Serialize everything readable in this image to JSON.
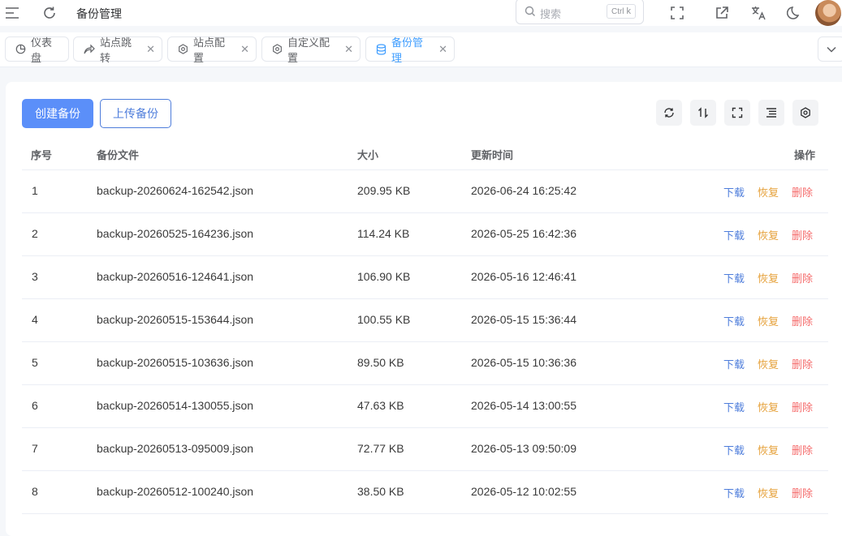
{
  "header": {
    "title": "备份管理",
    "search_placeholder": "搜索",
    "shortcut_key": "Ctrl",
    "shortcut_letter": "k"
  },
  "tabs": [
    {
      "label": "仪表盘",
      "icon": "dashboard-icon",
      "closable": false
    },
    {
      "label": "站点跳转",
      "icon": "share-arrow-icon",
      "closable": true
    },
    {
      "label": "站点配置",
      "icon": "gear-icon",
      "closable": true
    },
    {
      "label": "自定义配置",
      "icon": "gear-icon",
      "closable": true
    },
    {
      "label": "备份管理",
      "icon": "database-icon",
      "closable": true,
      "active": true
    }
  ],
  "toolbar": {
    "create_label": "创建备份",
    "upload_label": "上传备份"
  },
  "table": {
    "columns": [
      "序号",
      "备份文件",
      "大小",
      "更新时间",
      "操作"
    ],
    "actions": {
      "download": "下载",
      "restore": "恢复",
      "delete": "删除"
    },
    "rows": [
      {
        "no": "1",
        "file": "backup-20260624-162542.json",
        "size": "209.95 KB",
        "time": "2026-06-24 16:25:42"
      },
      {
        "no": "2",
        "file": "backup-20260525-164236.json",
        "size": "114.24 KB",
        "time": "2026-05-25 16:42:36"
      },
      {
        "no": "3",
        "file": "backup-20260516-124641.json",
        "size": "106.90 KB",
        "time": "2026-05-16 12:46:41"
      },
      {
        "no": "4",
        "file": "backup-20260515-153644.json",
        "size": "100.55 KB",
        "time": "2026-05-15 15:36:44"
      },
      {
        "no": "5",
        "file": "backup-20260515-103636.json",
        "size": "89.50 KB",
        "time": "2026-05-15 10:36:36"
      },
      {
        "no": "6",
        "file": "backup-20260514-130055.json",
        "size": "47.63 KB",
        "time": "2026-05-14 13:00:55"
      },
      {
        "no": "7",
        "file": "backup-20260513-095009.json",
        "size": "72.77 KB",
        "time": "2026-05-13 09:50:09"
      },
      {
        "no": "8",
        "file": "backup-20260512-100240.json",
        "size": "38.50 KB",
        "time": "2026-05-12 10:02:55"
      }
    ]
  },
  "colors": {
    "primary": "#5b8ff9",
    "link": "#4e7ddb",
    "warning": "#e6a23c",
    "danger": "#f56c6c"
  }
}
